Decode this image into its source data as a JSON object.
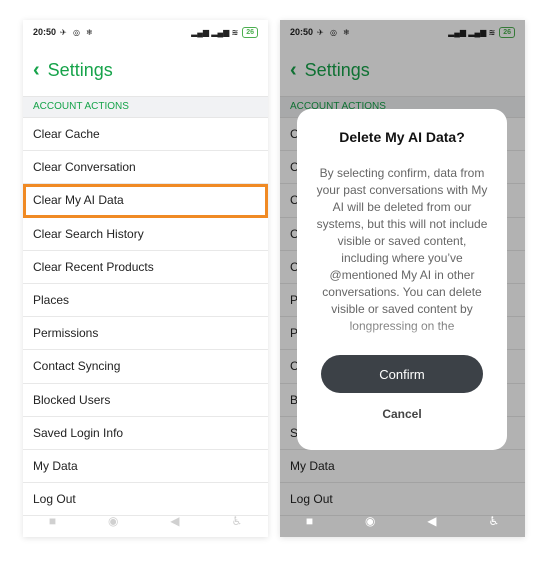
{
  "status": {
    "time": "20:50",
    "left_glyphs": "✈ ◎ ❄",
    "signal": "▂▄▆ ▂▄▆ ≋",
    "battery": "26"
  },
  "header": {
    "title": "Settings"
  },
  "section_title": "ACCOUNT ACTIONS",
  "items": [
    "Clear Cache",
    "Clear Conversation",
    "Clear My AI Data",
    "Clear Search History",
    "Clear Recent Products",
    "Places",
    "Permissions",
    "Contact Syncing",
    "Blocked Users",
    "Saved Login Info",
    "My Data",
    "Log Out"
  ],
  "nav": {
    "square": "■",
    "circle": "◉",
    "back": "◀",
    "accessibility": "♿"
  },
  "dialog": {
    "title": "Delete My AI Data?",
    "body": "By selecting confirm, data from your past conversations with My AI will be deleted from our systems, but this will not include visible or saved content, including where you’ve @mentioned My AI in other conversations. You can delete visible or saved content by longpressing on the",
    "confirm": "Confirm",
    "cancel": "Cancel"
  },
  "colors": {
    "accent": "#16a34a",
    "highlight": "#f08a24",
    "confirm_bg": "#3c4147"
  }
}
